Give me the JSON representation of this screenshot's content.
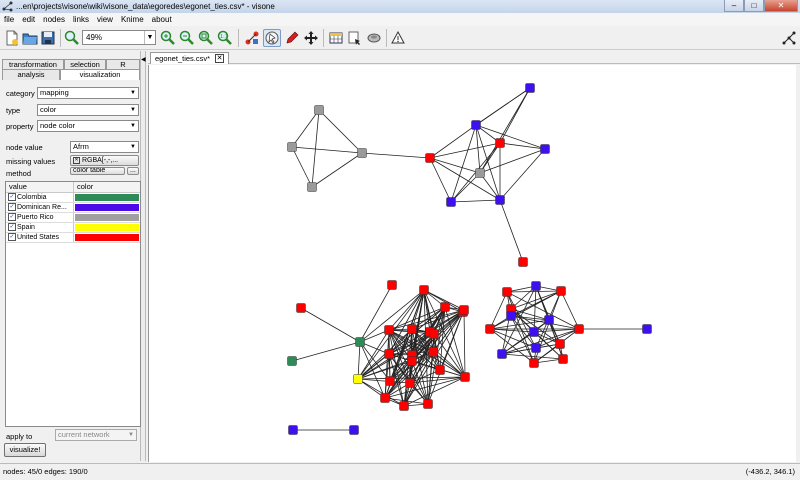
{
  "window": {
    "title": "...en\\projects\\visone\\wiki\\visone_data\\egoredes\\egonet_ties.csv* - visone",
    "minimize": "–",
    "maximize": "□",
    "close": "✕"
  },
  "menu": [
    "file",
    "edit",
    "nodes",
    "links",
    "view",
    "Knime",
    "about"
  ],
  "toolbar": {
    "zoom_value": "49%",
    "icons": [
      "new-file-icon",
      "open-folder-icon",
      "save-icon",
      "zoom-fit-icon",
      "zoom-in-icon",
      "zoom-out-icon",
      "zoom-region-icon",
      "zoom-reset-icon",
      "layout-icon",
      "select-tool-icon",
      "pen-tool-icon",
      "move-tool-icon",
      "table-icon",
      "lock-filter-icon",
      "network-db-icon",
      "triangle-warning-icon",
      "network-layout-icon"
    ]
  },
  "left_panel": {
    "tabs_top": [
      "transformation",
      "selection",
      "R console"
    ],
    "tabs_bottom": [
      "analysis",
      "visualization"
    ],
    "selected_tab": "visualization",
    "category_label": "category",
    "category_value": "mapping",
    "type_label": "type",
    "type_value": "color",
    "property_label": "property",
    "property_value": "node color",
    "node_value_label": "node value",
    "node_value_value": "Afrm",
    "missing_values_label": "missing values",
    "missing_values_value": "RGBA[-,-,...",
    "method_label": "method",
    "method_value": "color table",
    "method_extra": "...",
    "table_headers": [
      "value",
      "color"
    ],
    "table_rows": [
      {
        "checked": true,
        "label": "Colombia",
        "color": "#2e8b57"
      },
      {
        "checked": true,
        "label": "Dominican Re...",
        "color": "#4b0ae6"
      },
      {
        "checked": true,
        "label": "Puerto Rico",
        "color": "#a0a0a0"
      },
      {
        "checked": true,
        "label": "Spain",
        "color": "#ffff00"
      },
      {
        "checked": true,
        "label": "United States",
        "color": "#ff0000"
      }
    ],
    "apply_to_label": "apply to",
    "apply_to_value": "current network",
    "visualize_label": "visualize!"
  },
  "document_tab": "egonet_ties.csv*",
  "network": {
    "node_colors": {
      "G": "#2e8b57",
      "D": "#3f10ee",
      "P": "#9a9a9a",
      "S": "#ffff00",
      "U": "#ff0000"
    }
  },
  "status": {
    "left": "nodes: 45/0  edges: 190/0",
    "right": "(-436.2, 346.1)"
  }
}
